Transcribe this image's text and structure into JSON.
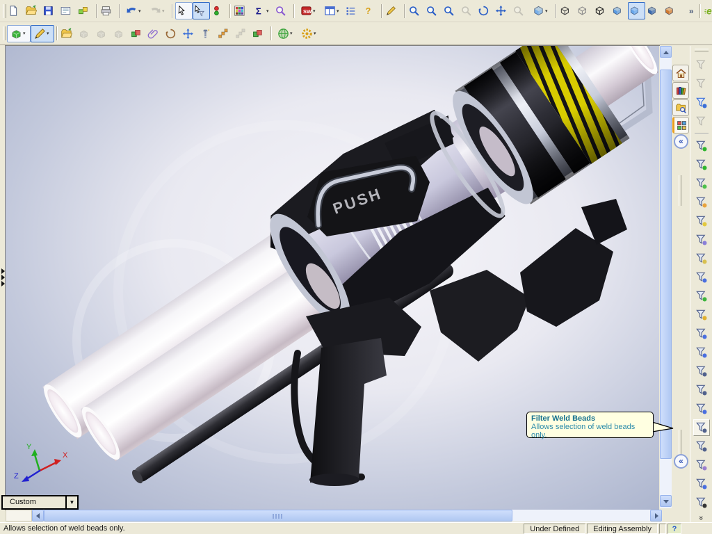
{
  "colors": {
    "toolbar_bg": "#ece9d8",
    "tooltip_bg": "#ffffe1",
    "tooltip_title": "#16718e",
    "tooltip_body": "#2d8cab",
    "viewport_center": "#f5f4f8",
    "viewport_edge": "#a3adc8",
    "hazard_yellow": "#d8cc00",
    "scroll_thumb": "#bcd0f4",
    "pressed_bg": "#cde0f7"
  },
  "toolbar_main": {
    "items": [
      {
        "n": "toolbar-grip",
        "cls": "tgrip",
        "ia": "false",
        "sym": "",
        "glyph": "",
        "ddg": ""
      },
      {
        "n": "new-button",
        "cls": "tbtn",
        "ia": "true",
        "sym": "#i-page",
        "glyph": "",
        "ddg": ""
      },
      {
        "n": "open-button",
        "cls": "tbtn",
        "ia": "true",
        "sym": "#i-folder",
        "glyph": "",
        "ddg": ""
      },
      {
        "n": "save-button",
        "cls": "tbtn",
        "ia": "true",
        "sym": "#i-floppy",
        "glyph": "",
        "ddg": ""
      },
      {
        "n": "make-drawing-button",
        "cls": "tbtn",
        "ia": "true",
        "sym": "#i-sheet",
        "glyph": "",
        "ddg": ""
      },
      {
        "n": "make-assembly-button",
        "cls": "tbtn",
        "ia": "true",
        "sym": "#i-asm",
        "glyph": "",
        "ddg": ""
      },
      {
        "n": "separator",
        "cls": "tsep",
        "ia": "false",
        "sym": "",
        "glyph": "",
        "ddg": ""
      },
      {
        "n": "print-button",
        "cls": "tbtn",
        "ia": "true",
        "sym": "#i-printer",
        "glyph": "",
        "ddg": ""
      },
      {
        "n": "separator",
        "cls": "tsep",
        "ia": "false",
        "sym": "",
        "glyph": "",
        "ddg": ""
      },
      {
        "n": "undo-button",
        "cls": "tbtn dd1",
        "ia": "true",
        "sym": "#i-curl",
        "istyle": "color:#2b5fc7",
        "glyph": "",
        "ddg": "▾"
      },
      {
        "n": "redo-button",
        "cls": "tbtn dd1 disabled",
        "ia": "true",
        "sym": "#i-curlr",
        "istyle": "color:#8a8a80",
        "glyph": "",
        "ddg": "▾"
      },
      {
        "n": "separator",
        "cls": "tsep",
        "ia": "false",
        "sym": "",
        "glyph": "",
        "ddg": ""
      },
      {
        "n": "select-button",
        "cls": "tbtn raised",
        "ia": "true",
        "sym": "#i-cursor",
        "glyph": "",
        "ddg": ""
      },
      {
        "n": "filter-select-button",
        "cls": "tbtn pressed",
        "ia": "true",
        "sym": "#i-cursorf",
        "glyph": "",
        "ddg": ""
      },
      {
        "n": "selection-colors-button",
        "cls": "tbtn",
        "ia": "true",
        "sym": "#i-traffic",
        "glyph": "",
        "ddg": ""
      },
      {
        "n": "separator",
        "cls": "tsep",
        "ia": "false",
        "sym": "",
        "glyph": "",
        "ddg": ""
      },
      {
        "n": "color-swatches-button",
        "cls": "tbtn",
        "ia": "true",
        "sym": "#i-palette",
        "glyph": "",
        "ddg": ""
      },
      {
        "n": "measure-button",
        "cls": "tbtn dd1",
        "ia": "true",
        "sym": "#i-sigma",
        "istyle": "color:#1a1a8c",
        "glyph": "",
        "ddg": "▾"
      },
      {
        "n": "check-model-button",
        "cls": "tbtn",
        "ia": "true",
        "sym": "#i-mag",
        "istyle": "color:#8a5ad0",
        "glyph": "",
        "ddg": ""
      },
      {
        "n": "separator",
        "cls": "tsep",
        "ia": "false",
        "sym": "",
        "glyph": "",
        "ddg": ""
      },
      {
        "n": "solidworks-office-button",
        "cls": "tbtn dd1",
        "ia": "true",
        "sym": "#i-swbox",
        "glyph": "",
        "ddg": "▾"
      },
      {
        "n": "view-pane-button",
        "cls": "tbtn dd1",
        "ia": "true",
        "sym": "#i-winpane",
        "istyle": "color:#4a6fd0",
        "glyph": "",
        "ddg": "▾"
      },
      {
        "n": "options-list-button",
        "cls": "tbtn",
        "ia": "true",
        "sym": "#i-list",
        "istyle": "color:#4a6fd0",
        "glyph": "",
        "ddg": ""
      },
      {
        "n": "help-button",
        "cls": "tbtn",
        "ia": "true",
        "sym": "#i-qmark",
        "istyle": "color:#d8a018",
        "glyph": "",
        "ddg": ""
      },
      {
        "n": "separator",
        "cls": "tsep",
        "ia": "false",
        "sym": "",
        "glyph": "",
        "ddg": ""
      },
      {
        "n": "stylus-select-button",
        "cls": "tbtn",
        "ia": "true",
        "sym": "#i-pen",
        "glyph": "",
        "ddg": ""
      },
      {
        "n": "separator",
        "cls": "tsep",
        "ia": "false",
        "sym": "",
        "glyph": "",
        "ddg": ""
      },
      {
        "n": "zoom-to-fit-button",
        "cls": "tbtn",
        "ia": "true",
        "sym": "#i-mag",
        "istyle": "color:#2b5fc7",
        "glyph": "",
        "ddg": ""
      },
      {
        "n": "zoom-to-area-button",
        "cls": "tbtn",
        "ia": "true",
        "sym": "#i-mag",
        "istyle": "color:#2b5fc7",
        "glyph": "",
        "ddg": ""
      },
      {
        "n": "zoom-in-out-button",
        "cls": "tbtn",
        "ia": "true",
        "sym": "#i-mag",
        "istyle": "color:#2b5fc7",
        "glyph": "",
        "ddg": ""
      },
      {
        "n": "zoom-to-selection-button",
        "cls": "tbtn disabled",
        "ia": "true",
        "sym": "#i-mag",
        "istyle": "color:#8a8a80",
        "glyph": "",
        "ddg": ""
      },
      {
        "n": "rotate-view-button",
        "cls": "tbtn",
        "ia": "true",
        "sym": "#i-rot",
        "istyle": "color:#2b5fc7",
        "glyph": "",
        "ddg": ""
      },
      {
        "n": "pan-button",
        "cls": "tbtn",
        "ia": "true",
        "sym": "#i-pan",
        "istyle": "color:#2b5fc7",
        "glyph": "",
        "ddg": ""
      },
      {
        "n": "zoom-window-button",
        "cls": "tbtn disabled",
        "ia": "true",
        "sym": "#i-mag",
        "istyle": "color:#8a8a80",
        "glyph": "",
        "ddg": ""
      },
      {
        "n": "view-orientation-button",
        "cls": "tbtn dd1",
        "ia": "true",
        "sym": "#i-cubes",
        "istyle": "color:#7ab0e8",
        "glyph": "",
        "ddg": "▾"
      },
      {
        "n": "separator",
        "cls": "tsep",
        "ia": "false",
        "sym": "",
        "glyph": "",
        "ddg": ""
      },
      {
        "n": "wireframe-button",
        "cls": "tbtn",
        "ia": "true",
        "sym": "#i-cubew",
        "istyle": "color:#444444",
        "glyph": "",
        "ddg": ""
      },
      {
        "n": "hidden-lines-visible-button",
        "cls": "tbtn",
        "ia": "true",
        "sym": "#i-cubew",
        "istyle": "color:#8a8a8a",
        "glyph": "",
        "ddg": ""
      },
      {
        "n": "hidden-lines-removed-button",
        "cls": "tbtn",
        "ia": "true",
        "sym": "#i-cubew",
        "istyle": "color:#222222",
        "glyph": "",
        "ddg": ""
      },
      {
        "n": "shaded-with-edges-button",
        "cls": "tbtn",
        "ia": "true",
        "sym": "#i-cubes",
        "istyle": "color:#5a9ae0",
        "glyph": "",
        "ddg": ""
      },
      {
        "n": "shaded-button",
        "cls": "tbtn pressed",
        "ia": "true",
        "sym": "#i-cubes",
        "istyle": "color:#6aa8ec",
        "glyph": "",
        "ddg": ""
      },
      {
        "n": "shadows-button",
        "cls": "tbtn",
        "ia": "true",
        "sym": "#i-cubes",
        "istyle": "color:#3a6ab0",
        "glyph": "",
        "ddg": ""
      },
      {
        "n": "section-view-button",
        "cls": "tbtn",
        "ia": "true",
        "sym": "#i-cubes",
        "istyle": "color:#d07a30",
        "glyph": "",
        "ddg": ""
      },
      {
        "n": "toolbar-overflow-button",
        "cls": "tbtn",
        "ia": "true",
        "sym": "",
        "glyph": "»",
        "ddg": ""
      },
      {
        "n": "separator",
        "cls": "tsep",
        "ia": "false",
        "sym": "",
        "glyph": "",
        "ddg": ""
      },
      {
        "n": "edrawings-button",
        "cls": "tbtn",
        "ia": "true",
        "sym": "#i-e",
        "istyle": "color:#7ab020",
        "glyph": "",
        "ddg": ""
      },
      {
        "n": "toolbar-overflow-button-2",
        "cls": "tbtn",
        "ia": "true",
        "sym": "",
        "glyph": "»",
        "ddg": ""
      }
    ]
  },
  "toolbar_assembly": {
    "items": [
      {
        "n": "toolbar-grip",
        "cls": "tgrip",
        "ia": "false",
        "sym": "",
        "glyph": "",
        "ddg": ""
      },
      {
        "n": "insert-component-button",
        "cls": "tbtn dd1 raised",
        "ia": "true",
        "sym": "#i-block",
        "istyle": "color:#3db53d",
        "glyph": "",
        "ddg": "▾"
      },
      {
        "n": "sketch-button",
        "cls": "tbtn dd1 pressed",
        "ia": "true",
        "sym": "#i-pen",
        "glyph": "",
        "ddg": "▾"
      },
      {
        "n": "separator",
        "cls": "tsep",
        "ia": "false",
        "sym": "",
        "glyph": "",
        "ddg": ""
      },
      {
        "n": "make-virtual-button",
        "cls": "tbtn",
        "ia": "true",
        "sym": "#i-folder",
        "glyph": "",
        "ddg": ""
      },
      {
        "n": "hide-components-button",
        "cls": "tbtn disabled",
        "ia": "true",
        "sym": "#i-block",
        "istyle": "color:#b0b0a4",
        "glyph": "",
        "ddg": ""
      },
      {
        "n": "component-pattern-button",
        "cls": "tbtn disabled",
        "ia": "true",
        "sym": "#i-block",
        "istyle": "color:#b0b0a4",
        "glyph": "",
        "ddg": ""
      },
      {
        "n": "mirror-components-button",
        "cls": "tbtn disabled",
        "ia": "true",
        "sym": "#i-block",
        "istyle": "color:#b0b0a4",
        "glyph": "",
        "ddg": ""
      },
      {
        "n": "replace-components-button",
        "cls": "tbtn",
        "ia": "true",
        "sym": "#i-x2",
        "glyph": "",
        "ddg": ""
      },
      {
        "n": "mate-button",
        "cls": "tbtn",
        "ia": "true",
        "sym": "#i-clip",
        "istyle": "color:#8a6ad0",
        "glyph": "",
        "ddg": ""
      },
      {
        "n": "rotate-component-button",
        "cls": "tbtn",
        "ia": "true",
        "sym": "#i-rot",
        "istyle": "color:#9a6a3a",
        "glyph": "",
        "ddg": ""
      },
      {
        "n": "move-component-button",
        "cls": "tbtn",
        "ia": "true",
        "sym": "#i-pan",
        "istyle": "color:#3a6fd8",
        "glyph": "",
        "ddg": ""
      },
      {
        "n": "smart-fasteners-button",
        "cls": "tbtn",
        "ia": "true",
        "sym": "#i-screw",
        "istyle": "color:#6a7a9a",
        "glyph": "",
        "ddg": ""
      },
      {
        "n": "exploded-view-button",
        "cls": "tbtn",
        "ia": "true",
        "sym": "#i-explode",
        "istyle": "color:#e09a3a",
        "glyph": "",
        "ddg": ""
      },
      {
        "n": "explode-line-sketch-button",
        "cls": "tbtn disabled",
        "ia": "true",
        "sym": "#i-explode",
        "istyle": "color:#b0b0a4",
        "glyph": "",
        "ddg": ""
      },
      {
        "n": "interference-detection-button",
        "cls": "tbtn",
        "ia": "true",
        "sym": "#i-x2",
        "glyph": "",
        "ddg": ""
      },
      {
        "n": "separator",
        "cls": "tsep",
        "ia": "false",
        "sym": "",
        "glyph": "",
        "ddg": ""
      },
      {
        "n": "appearances-button",
        "cls": "tbtn dd1",
        "ia": "true",
        "sym": "#i-globe",
        "istyle": "color:#3da53d",
        "glyph": "",
        "ddg": "▾"
      },
      {
        "n": "configurations-button",
        "cls": "tbtn dd1",
        "ia": "true",
        "sym": "#i-gear",
        "istyle": "color:#d8a018",
        "glyph": "",
        "ddg": "▾"
      }
    ]
  },
  "filter_toolbar": {
    "more_glyph": "»",
    "items": [
      {
        "n": "filter-toggle-button",
        "cls": "fbtn disabled",
        "ia": "true",
        "ac": "none"
      },
      {
        "n": "clear-all-filters-button",
        "cls": "fbtn disabled",
        "ia": "true",
        "ac": "none"
      },
      {
        "n": "select-all-filters-button",
        "cls": "fbtn",
        "ia": "true",
        "istyle": "color:#3a6fd8",
        "ac": "#3a6fd8"
      },
      {
        "n": "invert-selection-button",
        "cls": "fbtn disabled",
        "ia": "true",
        "ac": "none"
      },
      {
        "n": "separator",
        "cls": "fsep",
        "ia": "false",
        "ac": "none"
      },
      {
        "n": "filter-vertices-button",
        "cls": "fbtn",
        "ia": "true",
        "ac": "#2db52d"
      },
      {
        "n": "filter-edges-button",
        "cls": "fbtn",
        "ia": "true",
        "ac": "#2db52d"
      },
      {
        "n": "filter-faces-button",
        "cls": "fbtn",
        "ia": "true",
        "ac": "#4cc04c"
      },
      {
        "n": "filter-surface-bodies-button",
        "cls": "fbtn",
        "ia": "true",
        "ac": "#e8a33d"
      },
      {
        "n": "filter-solid-bodies-button",
        "cls": "fbtn",
        "ia": "true",
        "ac": "#e3c93e"
      },
      {
        "n": "filter-axes-button",
        "cls": "fbtn",
        "ia": "true",
        "ac": "#8a7fd8"
      },
      {
        "n": "filter-planes-button",
        "cls": "fbtn",
        "ia": "true",
        "ac": "#d8c050"
      },
      {
        "n": "filter-sketch-points-button",
        "cls": "fbtn",
        "ia": "true",
        "ac": "#4a6fe0"
      },
      {
        "n": "filter-sketch-segments-button",
        "cls": "fbtn",
        "ia": "true",
        "ac": "#3db53d"
      },
      {
        "n": "filter-midpoints-button",
        "cls": "fbtn",
        "ia": "true",
        "ac": "#e0b030"
      },
      {
        "n": "filter-center-marks-button",
        "cls": "fbtn",
        "ia": "true",
        "ac": "#4a6fe0"
      },
      {
        "n": "filter-dimensions-button",
        "cls": "fbtn",
        "ia": "true",
        "ac": "#4a6fe0"
      },
      {
        "n": "filter-surface-finish-symbols-button",
        "cls": "fbtn",
        "ia": "true",
        "ac": "#51618c"
      },
      {
        "n": "filter-geometric-tolerances-button",
        "cls": "fbtn",
        "ia": "true",
        "ac": "#51618c"
      },
      {
        "n": "filter-notes-button",
        "cls": "fbtn",
        "ia": "true",
        "ac": "#4a6fe0"
      },
      {
        "n": "filter-weld-beads-button",
        "cls": "fbtn hot",
        "ia": "true",
        "ac": "#51618c"
      },
      {
        "n": "filter-weld-symbols-button",
        "cls": "fbtn",
        "ia": "true",
        "ac": "#51618c"
      },
      {
        "n": "filter-cosmetic-threads-button",
        "cls": "fbtn",
        "ia": "true",
        "ac": "#9a7fd0"
      },
      {
        "n": "filter-blocks-button",
        "cls": "fbtn",
        "ia": "true",
        "ac": "#4a6fe0"
      },
      {
        "n": "filter-datum-targets-button",
        "cls": "fbtn",
        "ia": "true",
        "ac": "#333333"
      }
    ]
  },
  "task_pane": {
    "collapse_glyph": "«",
    "tabs": [
      {
        "n": "task-pane-tab-home",
        "cls": "ptab",
        "ia": "true",
        "sym": "#i-home"
      },
      {
        "n": "task-pane-tab-resources",
        "cls": "ptab",
        "ia": "true",
        "sym": "#i-books"
      },
      {
        "n": "task-pane-tab-design-library",
        "cls": "ptab",
        "ia": "true",
        "sym": "#i-fmag"
      },
      {
        "n": "task-pane-tab-file-explorer",
        "cls": "ptab active",
        "ia": "true",
        "sym": "#i-blocks4"
      }
    ]
  },
  "viewport": {
    "push_label": "PUSH",
    "triad": {
      "x": "X",
      "y": "Y",
      "z": "Z"
    }
  },
  "tooltip": {
    "title": "Filter Weld Beads",
    "body": "Allows selection of weld beads only."
  },
  "orientation_dropdown": {
    "value": "Custom",
    "arrow": "▼"
  },
  "status_bar": {
    "message": "Allows selection of weld beads only.",
    "dimension_state": "Under Defined",
    "mode": "Editing Assembly",
    "help_glyph": "?"
  }
}
